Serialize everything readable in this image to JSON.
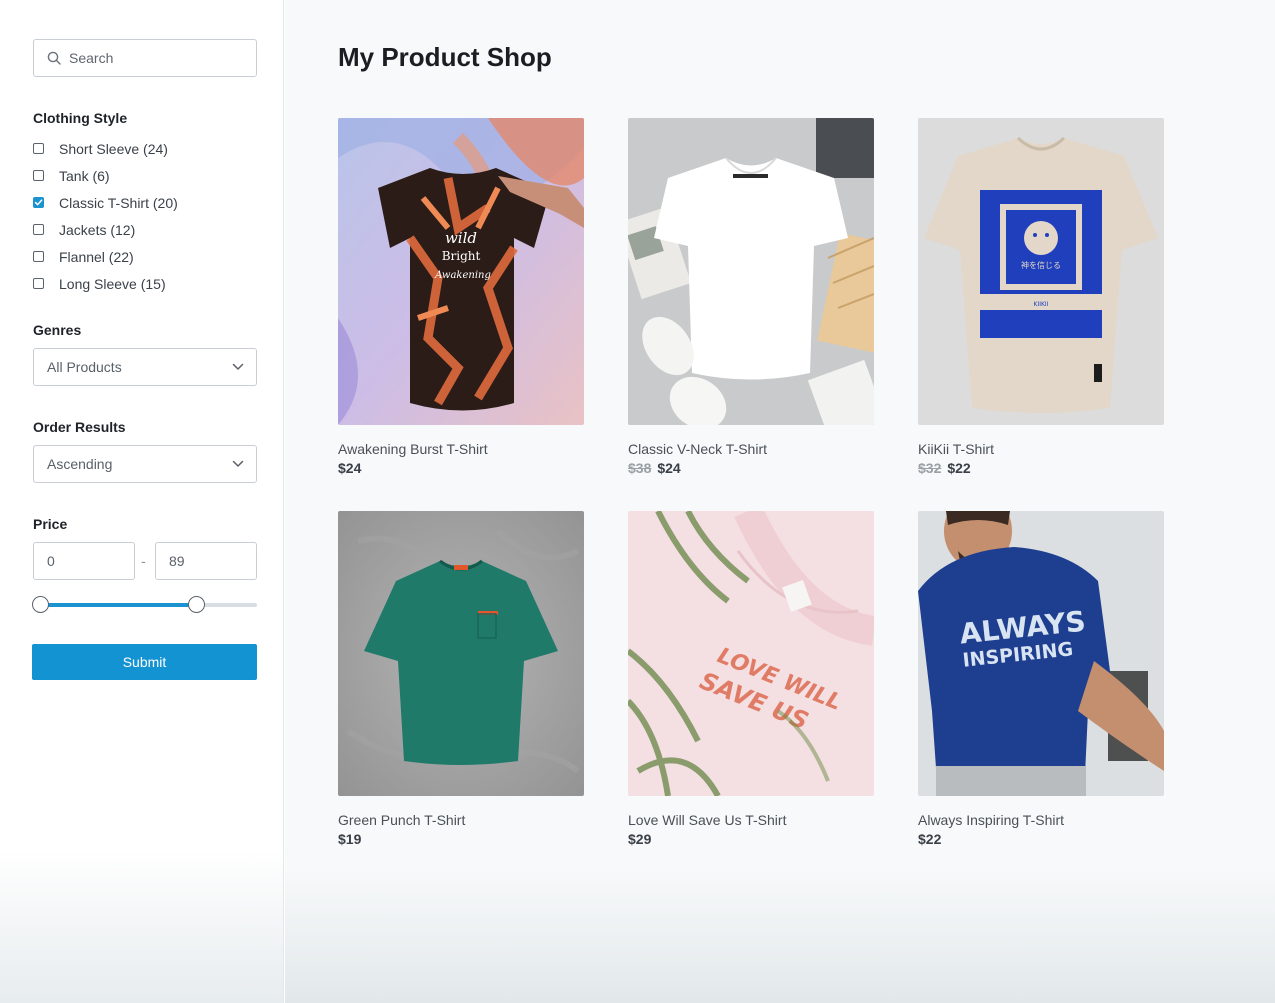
{
  "search": {
    "placeholder": "Search"
  },
  "filters": {
    "clothing_style": {
      "title": "Clothing Style",
      "options": [
        {
          "label": "Short Sleeve (24)",
          "checked": false
        },
        {
          "label": "Tank (6)",
          "checked": false
        },
        {
          "label": "Classic T-Shirt (20)",
          "checked": true
        },
        {
          "label": "Jackets (12)",
          "checked": false
        },
        {
          "label": "Flannel (22)",
          "checked": false
        },
        {
          "label": "Long Sleeve (15)",
          "checked": false
        }
      ]
    },
    "genres": {
      "title": "Genres",
      "selected": "All Products"
    },
    "order": {
      "title": "Order Results",
      "selected": "Ascending"
    },
    "price": {
      "title": "Price",
      "min": "0",
      "max": "89",
      "range_low_fraction": 0,
      "range_high_fraction": 0.72
    },
    "submit_label": "Submit"
  },
  "main": {
    "title": "My Product Shop",
    "products": [
      {
        "name": "Awakening Burst T-Shirt",
        "old_price": "",
        "price": "$24",
        "image": "tie-dye-shirt"
      },
      {
        "name": "Classic V-Neck T-Shirt",
        "old_price": "$38",
        "price": "$24",
        "image": "white-vneck-shirt"
      },
      {
        "name": "KiiKii T-Shirt",
        "old_price": "$32",
        "price": "$22",
        "image": "original-print-shirt"
      },
      {
        "name": "Green Punch T-Shirt",
        "old_price": "",
        "price": "$19",
        "image": "green-shirt"
      },
      {
        "name": "Love Will Save Us T-Shirt",
        "old_price": "",
        "price": "$29",
        "image": "pink-slogan-shirt"
      },
      {
        "name": "Always Inspiring T-Shirt",
        "old_price": "",
        "price": "$22",
        "image": "blue-model-shirt"
      }
    ],
    "image_text": {
      "wild": "wild",
      "bright": "Bright",
      "awakening": "Awakening",
      "kiikii": "KIIKII",
      "kanji": "神を信じる",
      "original": "ORIGINAL",
      "love_line1": "LOVE WILL",
      "love_line2": "SAVE US",
      "always_line1": "ALWAYS",
      "always_line2": "INSPIRING"
    }
  },
  "colors": {
    "accent": "#1493d2",
    "page_bg": "#f7f9fa"
  }
}
